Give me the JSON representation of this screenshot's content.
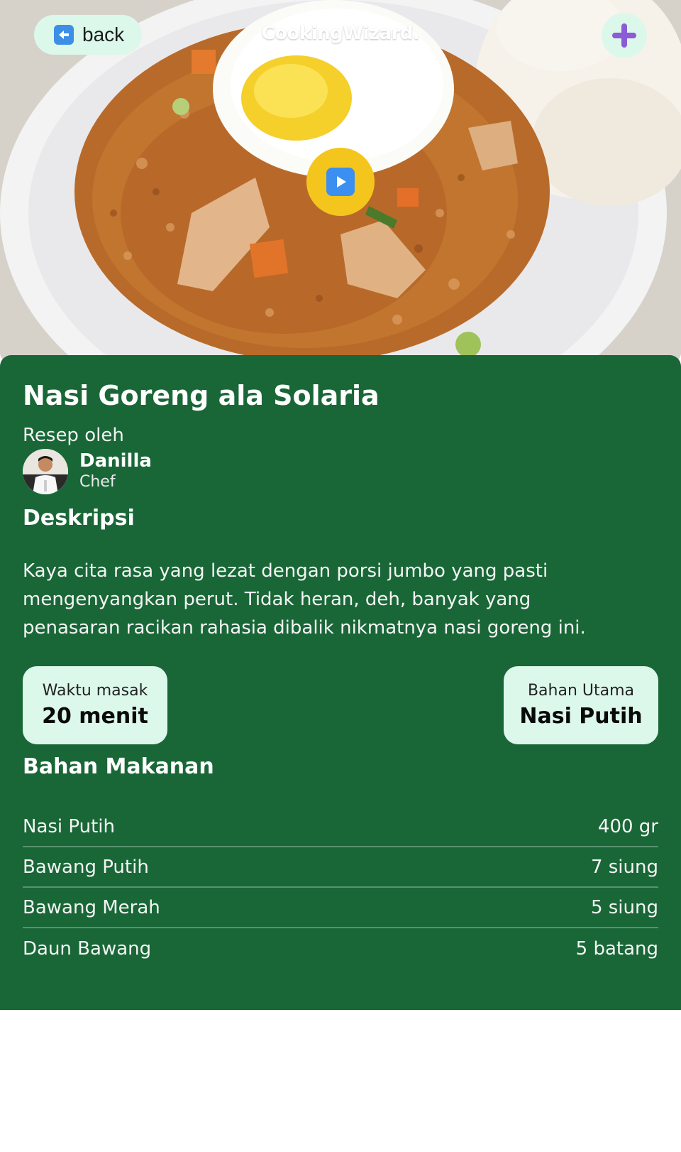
{
  "header": {
    "back_label": "back",
    "back_icon": "left-arrow-icon",
    "brand": "CookingWizard.",
    "add_icon": "plus-icon",
    "play_icon": "play-icon"
  },
  "recipe": {
    "title": "Nasi Goreng ala Solaria",
    "by_label": "Resep oleh",
    "author": {
      "name": "Danilla",
      "role": "Chef"
    },
    "description_heading": "Deskripsi",
    "description": "Kaya cita rasa yang lezat dengan porsi jumbo yang pasti mengenyangkan perut. Tidak heran, deh, banyak yang penasaran racikan rahasia dibalik nikmatnya nasi goreng ini.",
    "cook_time": {
      "label": "Waktu masak",
      "value": "20 menit"
    },
    "main_ingredient": {
      "label": "Bahan Utama",
      "value": "Nasi Putih"
    },
    "ingredients_heading": "Bahan Makanan",
    "ingredients": [
      {
        "name": "Nasi Putih",
        "qty": "400 gr"
      },
      {
        "name": "Bawang Putih",
        "qty": "7 siung"
      },
      {
        "name": "Bawang Merah",
        "qty": "5 siung"
      },
      {
        "name": "Daun Bawang",
        "qty": "5 batang"
      }
    ]
  },
  "colors": {
    "panel": "#196737",
    "card": "#dcf8ea",
    "play": "#f4c51c",
    "plus": "#8a5cd6",
    "arrow_box": "#3d8fe6"
  }
}
